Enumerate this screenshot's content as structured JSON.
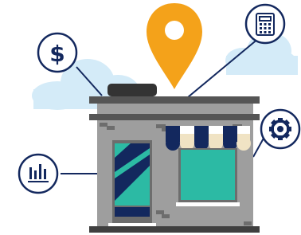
{
  "scene": {
    "store": {
      "windows": 2,
      "awning_stripes": 6
    },
    "badges": [
      {
        "icon": "dollar-sign-icon",
        "glyph": "$"
      },
      {
        "icon": "calculator-icon",
        "glyph": ""
      },
      {
        "icon": "gear-icon",
        "glyph": ""
      },
      {
        "icon": "bar-chart-icon",
        "glyph": ""
      }
    ]
  },
  "colors": {
    "navy": "#13285e",
    "teal": "#2cbaa4",
    "orange": "#f4a21a",
    "cloud": "#d4ebf8",
    "wall": "#9e9e9e",
    "wall_dark": "#6d6d6d",
    "roof": "#333333",
    "ground": "#3f3f3f",
    "white": "#ffffff"
  }
}
